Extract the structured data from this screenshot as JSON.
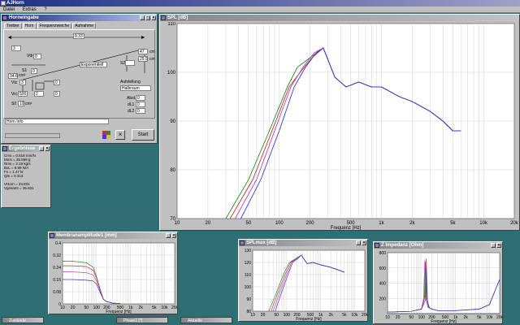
{
  "app": {
    "title": "AJHorn"
  },
  "menu": [
    "Datei",
    "Extras",
    "?"
  ],
  "horn_window": {
    "title": "Horneingabe",
    "tabs": [
      "Treiber",
      "Horn",
      "Frequenzweiche",
      "Aufnahme"
    ],
    "selected_tab": "Horn",
    "fields": {
      "top_dim": "0.33",
      "left_len": "3",
      "vas_label": "Vtb",
      "vas": "0",
      "right_a": "47",
      "right_a_unit": "cm",
      "right_b": "29.5",
      "right_b_unit": "cm",
      "s2_label": "S2",
      "s2": "",
      "profile": "Exponentiell",
      "s1_label": "S1",
      "s1": "34.6",
      "s1_unit": "cm²",
      "vx_label": "Vtc",
      "vx": "3",
      "r1": "0",
      "r2": "0",
      "vr_label": "Vrc",
      "vr": "500",
      "l1": "2",
      "l2": "0",
      "s0_label": "S0",
      "s0": "10",
      "s0_unit": "cm²",
      "aufstellung_label": "Aufstellung",
      "aufstellung": "Halbraum",
      "abst_label": "Abst.",
      "abst": "0",
      "dl1_label": "dL1",
      "dl1": "0",
      "dl2_label": "dL2",
      "dl2": "0",
      "name": "Horn Info",
      "start_label": "Start"
    }
  },
  "results_window": {
    "title": "Ergebnisse",
    "lines": [
      "Cms = 0.618 mm/N",
      "Mms = 25.599 g",
      "Rms = 2.19 kg/s",
      "BxL = 9.99 N/A",
      "Fs = 1.47 kr",
      "Qts = 0.313",
      "",
      "VHorn = 23.831",
      "Vgesamt = 35.831"
    ]
  },
  "spl_window": {
    "title": "SPL [dB]",
    "xlabel": "Frequenz [Hz]",
    "y_ticks": [
      "110",
      "100",
      "90",
      "80",
      "70"
    ],
    "x_ticks": [
      "10",
      "20",
      "50",
      "100",
      "200",
      "500",
      "1k",
      "2k",
      "5k",
      "10k",
      "20k"
    ]
  },
  "membrane_window": {
    "title": "Membranamplitude1 [mm]",
    "xlabel": "Frequenz [Hz]",
    "y_ticks": [
      "0.4",
      "0.32",
      "0.24",
      "0.16",
      "0.08",
      "0"
    ],
    "x_ticks": [
      "10",
      "20",
      "50",
      "100",
      "200",
      "500",
      "1k",
      "2k",
      "5k",
      "10k",
      "20k"
    ]
  },
  "spl2_window": {
    "title": "SPLmax [dB]",
    "xlabel": "Frequenz [Hz]",
    "y_ticks": [
      "130",
      "120",
      "110",
      "100",
      "90",
      "80"
    ],
    "x_ticks": [
      "10",
      "20",
      "50",
      "100",
      "200",
      "500",
      "1k",
      "2k",
      "5k",
      "10k",
      "20k"
    ]
  },
  "impedance_window": {
    "title": "Z Impedanz [Ohm]",
    "xlabel": "Frequenz [Hz]",
    "y_ticks": [
      "800",
      "600",
      "400",
      "200"
    ],
    "x_ticks": [
      "10",
      "20",
      "50",
      "100",
      "200",
      "500",
      "1k",
      "2k",
      "5k",
      "10k",
      "20k"
    ]
  },
  "taskbar": [
    "Zustände",
    "Phase1 [°]",
    "Aktuelle"
  ],
  "colors": {
    "series": [
      "#2a8a2a",
      "#c83232",
      "#b04ab0",
      "#3a3ad8"
    ],
    "highlight": "#1e2f88",
    "desktop": "#2e6f73"
  },
  "chart_data": [
    {
      "type": "line",
      "title": "SPL [dB]",
      "xlabel": "Frequenz [Hz]",
      "ylabel": "",
      "xscale": "log",
      "xlim": [
        10,
        20000
      ],
      "ylim": [
        70,
        110
      ],
      "series": [
        {
          "x": [
            30,
            50,
            80,
            120,
            150,
            200,
            270,
            350,
            450,
            600,
            800,
            1000,
            1500,
            2000,
            3000,
            4000,
            5000,
            6000
          ],
          "y": [
            70,
            78,
            88,
            97,
            101,
            103,
            105,
            99,
            97,
            98,
            97,
            97,
            95,
            94,
            92,
            90,
            88,
            88
          ]
        },
        {
          "x": [
            33,
            55,
            85,
            125,
            160,
            210,
            270,
            350,
            450,
            600,
            800,
            1000,
            1500,
            2000,
            3000,
            4000,
            5000,
            6000
          ],
          "y": [
            70,
            78,
            88,
            97,
            100,
            103,
            105,
            99,
            97,
            98,
            97,
            97,
            95,
            94,
            92,
            90,
            88,
            88
          ]
        },
        {
          "x": [
            37,
            60,
            90,
            130,
            170,
            220,
            270,
            350,
            450,
            600,
            800,
            1000,
            1500,
            2000,
            3000,
            4000,
            5000,
            6000
          ],
          "y": [
            70,
            78,
            88,
            97,
            101,
            104,
            105,
            99,
            97,
            98,
            97,
            97,
            95,
            94,
            92,
            90,
            88,
            88
          ]
        },
        {
          "x": [
            42,
            66,
            100,
            140,
            180,
            230,
            270,
            350,
            450,
            600,
            800,
            1000,
            1500,
            2000,
            3000,
            4000,
            5000,
            6000
          ],
          "y": [
            70,
            78,
            88,
            97,
            101,
            104,
            105,
            99,
            97,
            98,
            97,
            97,
            95,
            94,
            92,
            90,
            88,
            88
          ]
        }
      ]
    },
    {
      "type": "line",
      "title": "Membranamplitude1 [mm]",
      "xlabel": "Frequenz [Hz]",
      "ylabel": "",
      "xscale": "log",
      "xlim": [
        10,
        20000
      ],
      "ylim": [
        0,
        0.4
      ],
      "series": [
        {
          "x": [
            10,
            20,
            50,
            80,
            100,
            130,
            160,
            200,
            300,
            500
          ],
          "y": [
            0.28,
            0.28,
            0.27,
            0.24,
            0.18,
            0.09,
            0.03,
            0.015,
            0.005,
            0.002
          ]
        },
        {
          "x": [
            10,
            20,
            50,
            80,
            100,
            130,
            160,
            200,
            300,
            500
          ],
          "y": [
            0.25,
            0.25,
            0.245,
            0.22,
            0.17,
            0.09,
            0.03,
            0.015,
            0.005,
            0.002
          ]
        },
        {
          "x": [
            10,
            20,
            50,
            80,
            100,
            130,
            160,
            200,
            300,
            500
          ],
          "y": [
            0.21,
            0.21,
            0.205,
            0.19,
            0.15,
            0.08,
            0.03,
            0.015,
            0.005,
            0.002
          ]
        },
        {
          "x": [
            10,
            20,
            50,
            80,
            100,
            130,
            160,
            200,
            300,
            500
          ],
          "y": [
            0.16,
            0.16,
            0.155,
            0.15,
            0.13,
            0.07,
            0.03,
            0.015,
            0.005,
            0.002
          ]
        }
      ]
    },
    {
      "type": "line",
      "title": "SPLmax [dB]",
      "xlabel": "Frequenz [Hz]",
      "ylabel": "",
      "xscale": "log",
      "xlim": [
        10,
        20000
      ],
      "ylim": [
        80,
        130
      ],
      "series": [
        {
          "x": [
            30,
            50,
            80,
            120,
            180,
            270,
            400,
            600,
            1000,
            2000,
            5000
          ],
          "y": [
            80,
            95,
            110,
            120,
            123,
            126,
            119,
            120,
            118,
            116,
            112
          ]
        },
        {
          "x": [
            35,
            55,
            90,
            130,
            190,
            270,
            400,
            600,
            1000,
            2000,
            5000
          ],
          "y": [
            80,
            95,
            110,
            120,
            123,
            126,
            119,
            120,
            118,
            116,
            112
          ]
        },
        {
          "x": [
            40,
            62,
            100,
            140,
            200,
            270,
            400,
            600,
            1000,
            2000,
            5000
          ],
          "y": [
            80,
            95,
            110,
            120,
            123,
            126,
            119,
            120,
            118,
            116,
            112
          ]
        },
        {
          "x": [
            46,
            70,
            110,
            150,
            210,
            270,
            400,
            600,
            1000,
            2000,
            5000
          ],
          "y": [
            80,
            95,
            110,
            120,
            123,
            126,
            119,
            120,
            118,
            116,
            112
          ]
        }
      ]
    },
    {
      "type": "line",
      "title": "Z Impedanz [Ohm]",
      "xlabel": "Frequenz [Hz]",
      "ylabel": "",
      "xscale": "log",
      "xlim": [
        10,
        20000
      ],
      "ylim": [
        0,
        800
      ],
      "series": [
        {
          "x": [
            10,
            50,
            100,
            120,
            130,
            140,
            160,
            200,
            300,
            1000,
            5000,
            10000,
            20000
          ],
          "y": [
            20,
            30,
            60,
            200,
            680,
            180,
            80,
            60,
            40,
            40,
            60,
            120,
            450
          ]
        },
        {
          "x": [
            10,
            50,
            100,
            125,
            135,
            145,
            165,
            200,
            300,
            1000,
            5000,
            10000,
            20000
          ],
          "y": [
            20,
            30,
            60,
            220,
            720,
            200,
            80,
            60,
            40,
            40,
            60,
            120,
            450
          ]
        },
        {
          "x": [
            10,
            50,
            100,
            115,
            125,
            135,
            155,
            200,
            300,
            1000,
            5000,
            10000,
            20000
          ],
          "y": [
            20,
            30,
            60,
            200,
            700,
            190,
            80,
            60,
            40,
            40,
            60,
            120,
            450
          ]
        },
        {
          "x": [
            10,
            50,
            100,
            130,
            140,
            150,
            170,
            200,
            300,
            1000,
            5000,
            10000,
            20000
          ],
          "y": [
            20,
            30,
            60,
            180,
            600,
            160,
            80,
            60,
            40,
            40,
            60,
            120,
            450
          ]
        }
      ]
    }
  ]
}
